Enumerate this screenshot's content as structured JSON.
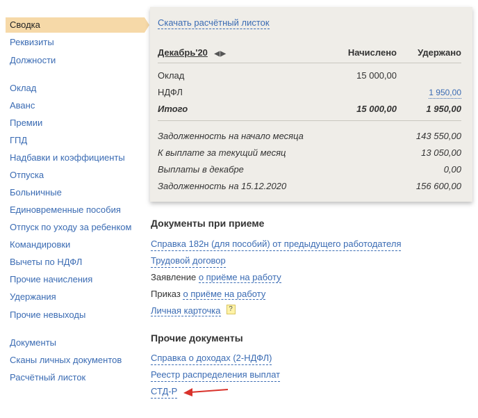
{
  "sidebar": {
    "active": "Сводка",
    "group1": [
      "Реквизиты",
      "Должности"
    ],
    "group2": [
      "Оклад",
      "Аванс",
      "Премии",
      "ГПД",
      "Надбавки и коэффициенты",
      "Отпуска",
      "Больничные",
      "Единовременные пособия",
      "Отпуск по уходу за ребенком",
      "Командировки",
      "Вычеты по НДФЛ",
      "Прочие начисления",
      "Удержания",
      "Прочие невыходы"
    ],
    "group3": [
      "Документы",
      "Сканы личных документов",
      "Расчётный листок"
    ]
  },
  "payslip": {
    "download_link": "Скачать расчётный листок",
    "month": "Декабрь'20",
    "col_accrued": "Начислено",
    "col_withheld": "Удержано",
    "rows": [
      {
        "label": "Оклад",
        "accrued": "15 000,00",
        "withheld": ""
      },
      {
        "label": "НДФЛ",
        "accrued": "",
        "withheld": "1 950,00"
      }
    ],
    "total": {
      "label": "Итого",
      "accrued": "15 000,00",
      "withheld": "1 950,00"
    },
    "summary": [
      {
        "label": "Задолженность на начало месяца",
        "value": "143 550,00"
      },
      {
        "label": "К выплате за текущий месяц",
        "value": "13 050,00"
      },
      {
        "label": "Выплаты в декабре",
        "value": "0,00"
      },
      {
        "label": "Задолженность на 15.12.2020",
        "value": "156 600,00"
      }
    ]
  },
  "hiring_docs": {
    "title": "Документы при приеме",
    "spravka": "Справка 182н (для пособий) от предыдущего работодателя",
    "contract": "Трудовой договор",
    "statement_prefix": "Заявление",
    "statement_link": "о приёме на работу",
    "order_prefix": "Приказ",
    "order_link": "о приёме на работу",
    "card": "Личная карточка",
    "help": "?"
  },
  "other_docs": {
    "title": "Прочие документы",
    "items": [
      "Справка о доходах (2-НДФЛ)",
      "Реестр распределения выплат",
      "СТД-Р"
    ]
  },
  "colors": {
    "accent": "#f6d9a8",
    "link": "#3a6bb3",
    "annotation_arrow": "#d9322b"
  }
}
